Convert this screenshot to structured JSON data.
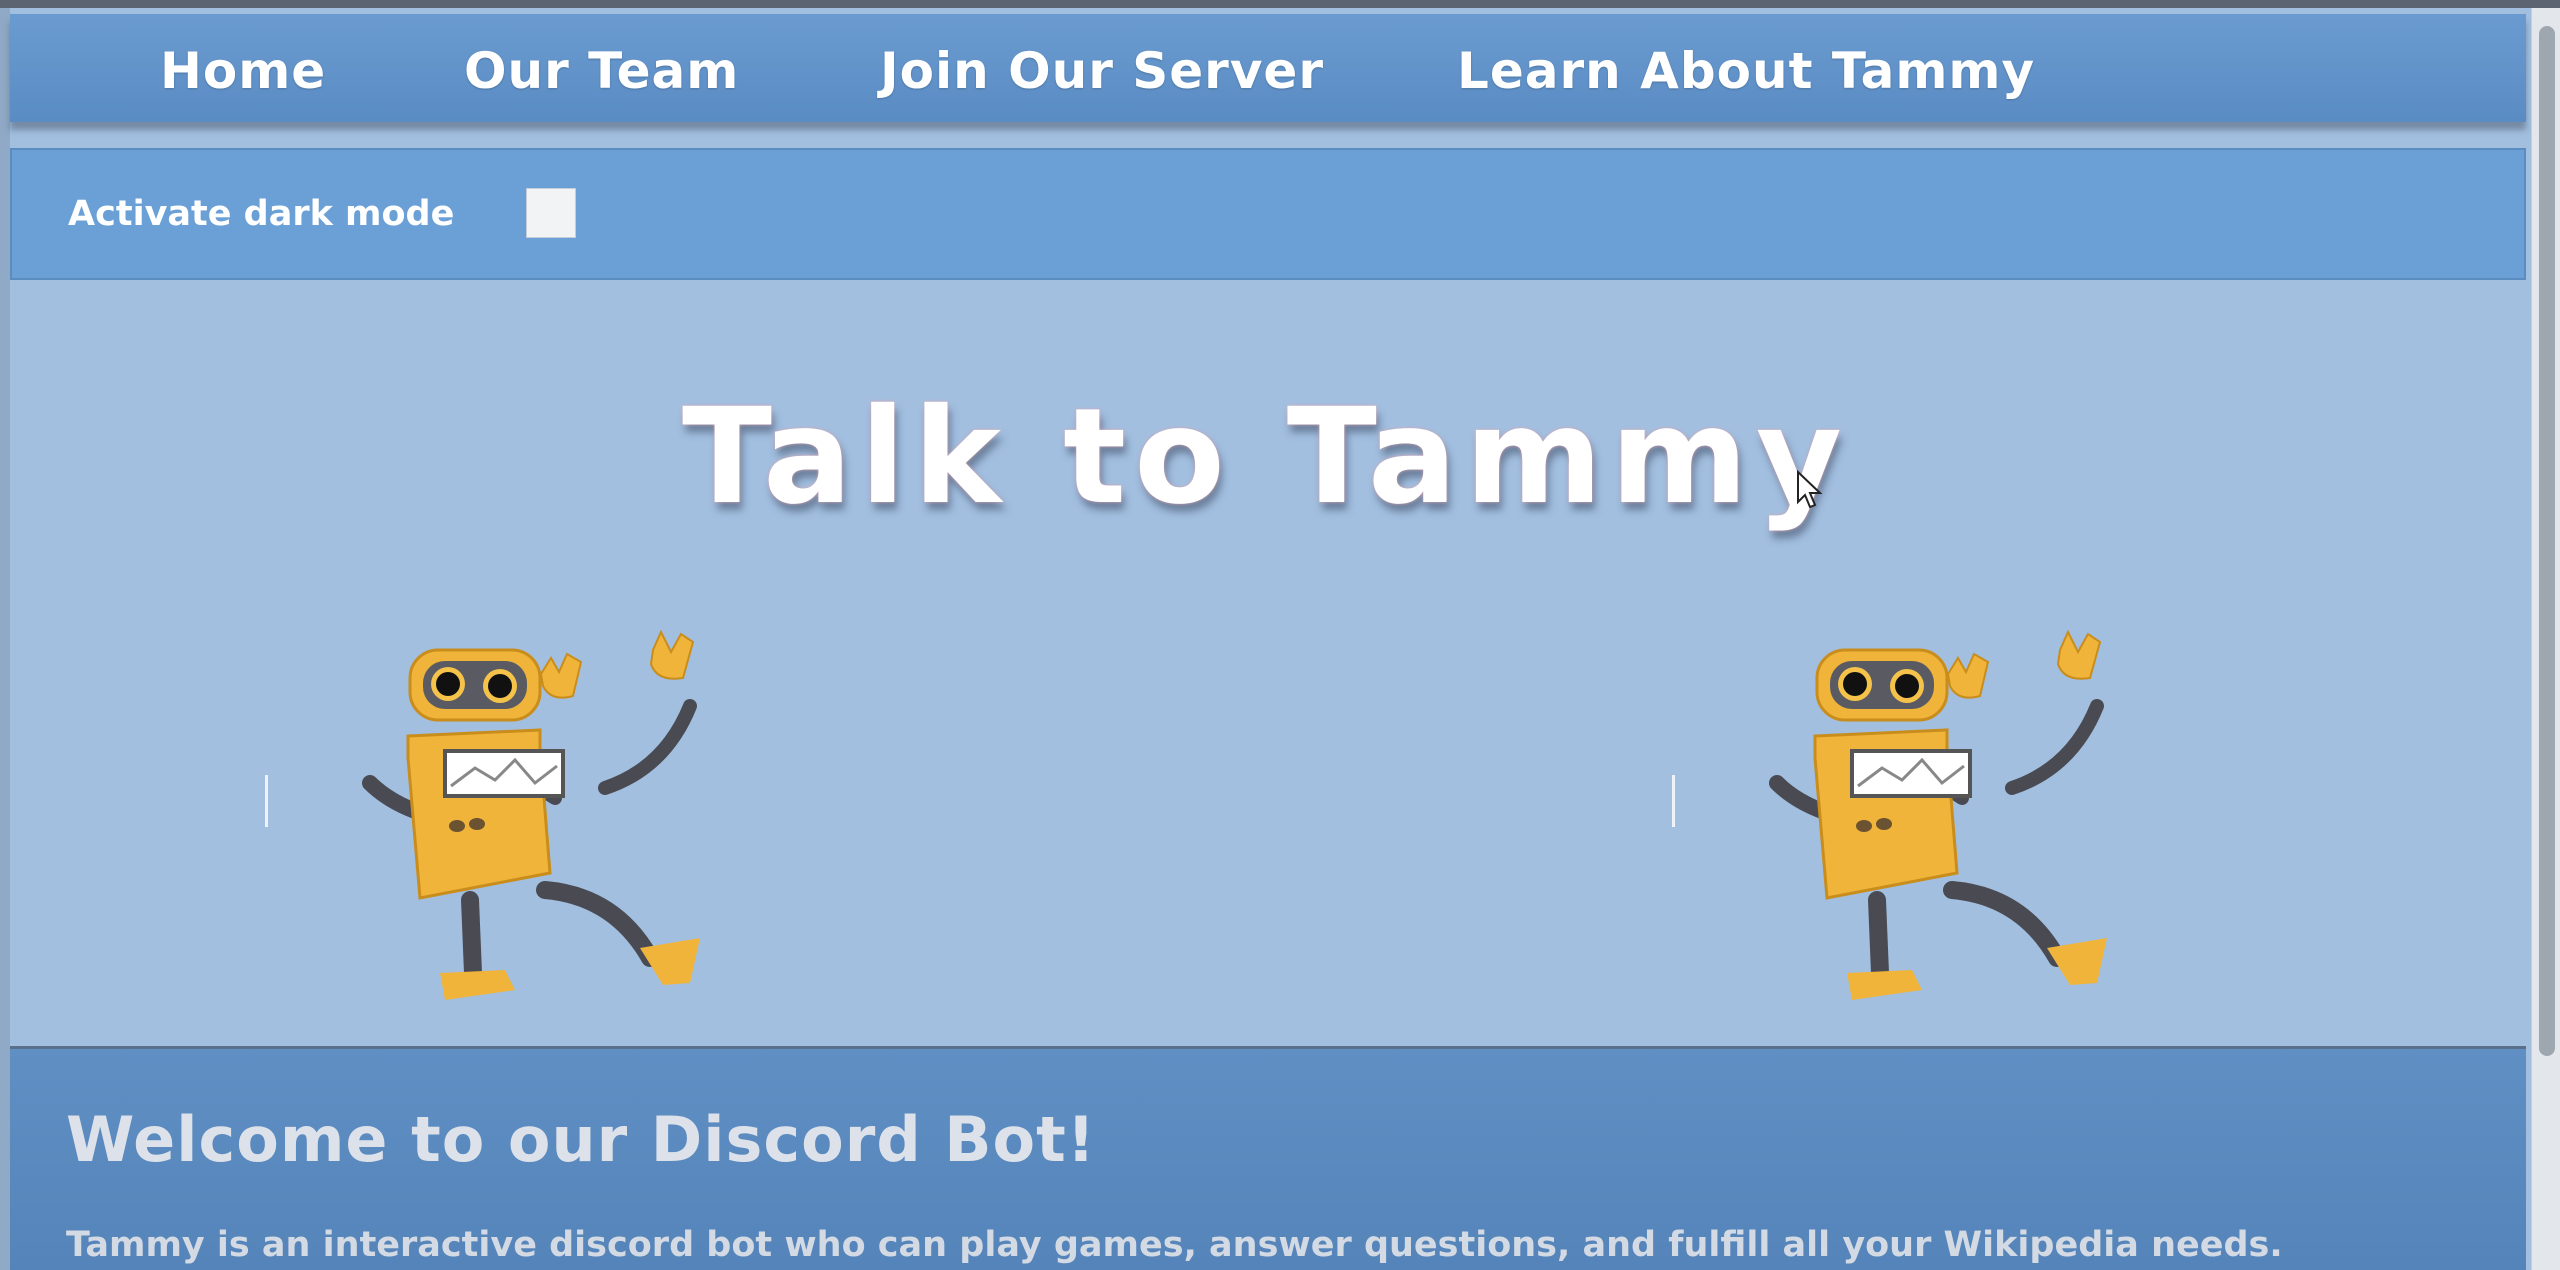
{
  "nav": {
    "items": [
      {
        "label": "Home"
      },
      {
        "label": "Our Team"
      },
      {
        "label": "Join Our Server"
      },
      {
        "label": "Learn About Tammy"
      }
    ]
  },
  "settings": {
    "dark_mode_label": "Activate dark mode",
    "dark_mode_checked": false
  },
  "hero": {
    "title": "Talk to Tammy"
  },
  "welcome": {
    "title": "Welcome to our Discord Bot!",
    "text": "Tammy is an interactive discord bot who can play games, answer questions, and fulfill all your Wikipedia needs."
  },
  "colors": {
    "nav_bg": "#5f92c9",
    "page_bg": "#a2bfe0",
    "robot_body": "#f0b43a"
  },
  "icons": {
    "robot": "robot-mascot",
    "cursor": "mouse-pointer-icon"
  }
}
